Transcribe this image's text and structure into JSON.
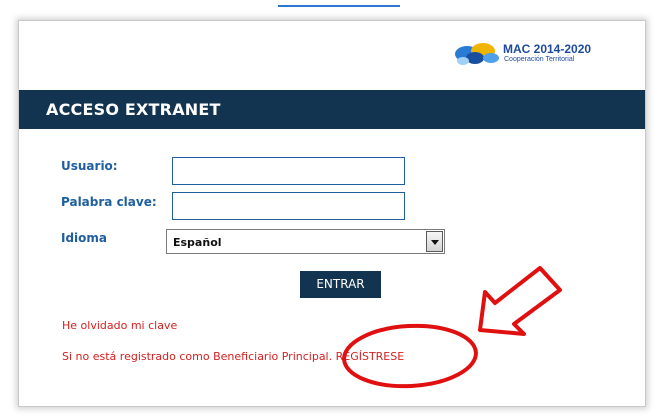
{
  "header": {
    "title": "ACCESO EXTRANET"
  },
  "logo": {
    "main": "MAC 2014-2020",
    "sub": "Cooperación Territorial"
  },
  "form": {
    "user_label": "Usuario:",
    "user_value": "",
    "password_label": "Palabra clave:",
    "password_value": "",
    "language_label": "Idioma",
    "language_selected": "Español",
    "submit_label": "ENTRAR"
  },
  "links": {
    "forgot_password": "He olvidado mi clave",
    "register_prompt": "Si no está registrado como Beneficiario Principal. REGÍSTRESE"
  },
  "colors": {
    "header_bg": "#133451",
    "label": "#1f5fa0",
    "link_red": "#d42020",
    "annotation_red": "#e01010"
  },
  "annotations": {
    "arrow_icon": "red-arrow-icon",
    "circle_icon": "red-circle-icon"
  }
}
